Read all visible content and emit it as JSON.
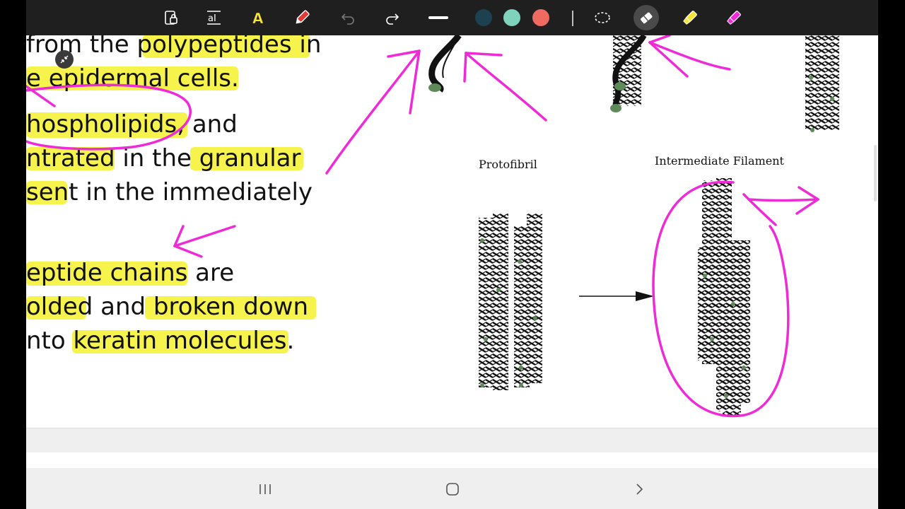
{
  "toolbar": {
    "tools": [
      {
        "icon": "lock-page-icon"
      },
      {
        "icon": "text-box-icon",
        "label": "aI"
      },
      {
        "icon": "text-highlighter-icon",
        "label": "A"
      },
      {
        "icon": "pen-icon"
      },
      {
        "icon": "undo-icon"
      },
      {
        "icon": "redo-icon"
      },
      {
        "icon": "line-thickness-icon"
      },
      {
        "icon": "lasso-icon"
      },
      {
        "icon": "eraser-icon"
      },
      {
        "icon": "highlighter-yellow-icon"
      },
      {
        "icon": "highlighter-pink-icon"
      }
    ],
    "colors": [
      "#1d4150",
      "#7fd3bd",
      "#ef6b61"
    ],
    "active_tool": "eraser"
  },
  "document": {
    "lines": [
      "from the polypeptides in",
      "e epidermal cells.",
      "hospholipids, and",
      "ntrated in the granular",
      "sent in the immediately",
      "eptide chains are",
      "olded and broken down",
      "nto keratin molecules."
    ],
    "figure": {
      "label_left": "Protofibril",
      "label_right": "Intermediate Filament"
    }
  },
  "colors": {
    "highlight": "#f5f23a",
    "ink_pink": "#ee2bd6",
    "toolbar_bg": "#1f1f1f",
    "helix": "#111111",
    "helix_tip": "#5e8a5a"
  },
  "navbar": {
    "buttons": [
      "recent-apps-icon",
      "home-icon",
      "back-icon"
    ]
  }
}
